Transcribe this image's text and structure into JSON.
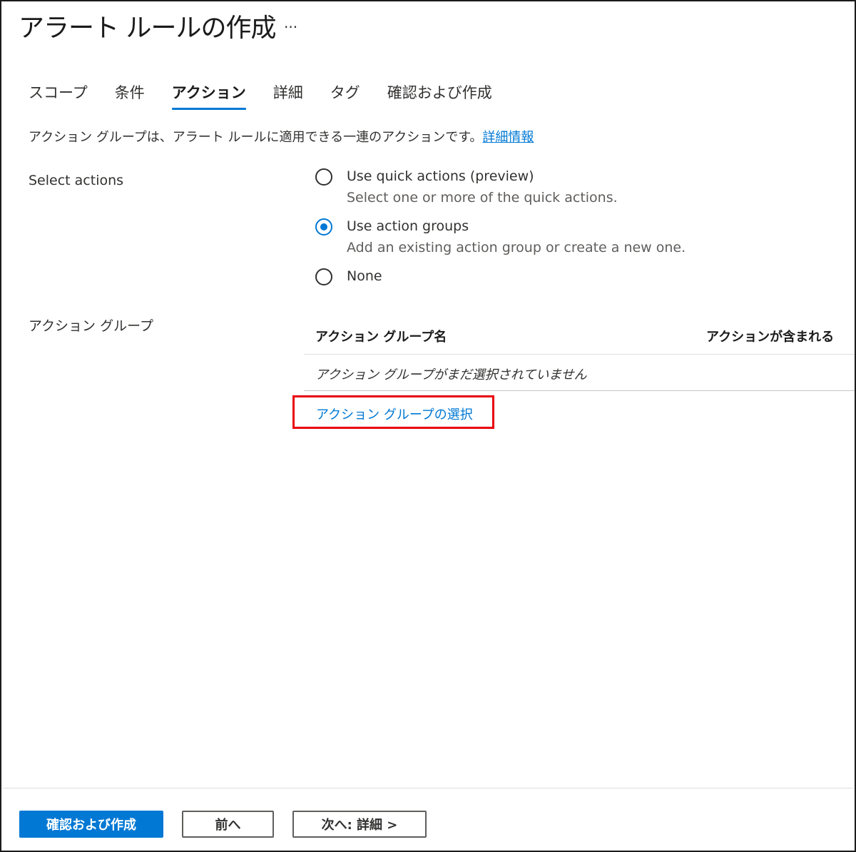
{
  "header": {
    "title": "アラート ルールの作成",
    "more_label": "..."
  },
  "tabs": [
    {
      "label": "スコープ",
      "active": false
    },
    {
      "label": "条件",
      "active": false
    },
    {
      "label": "アクション",
      "active": true
    },
    {
      "label": "詳細",
      "active": false
    },
    {
      "label": "タグ",
      "active": false
    },
    {
      "label": "確認および作成",
      "active": false
    }
  ],
  "description": {
    "text": "アクション グループは、アラート ルールに適用できる一連のアクションです。",
    "link": "詳細情報"
  },
  "select_actions": {
    "label": "Select actions",
    "options": [
      {
        "label": "Use quick actions (preview)",
        "sub": "Select one or more of the quick actions.",
        "selected": false
      },
      {
        "label": "Use action groups",
        "sub": "Add an existing action group or create a new one.",
        "selected": true
      },
      {
        "label": "None",
        "sub": "",
        "selected": false
      }
    ]
  },
  "action_groups": {
    "label": "アクション グループ",
    "columns": [
      "アクション グループ名",
      "アクションが含まれる"
    ],
    "empty_text": "アクション グループがまだ選択されていません",
    "select_link": "アクション グループの選択",
    "highlight_color": "#e8000b"
  },
  "footer": {
    "review_create": "確認および作成",
    "previous": "前へ",
    "next": "次へ: 詳細 >"
  },
  "colors": {
    "accent": "#0078d4"
  }
}
